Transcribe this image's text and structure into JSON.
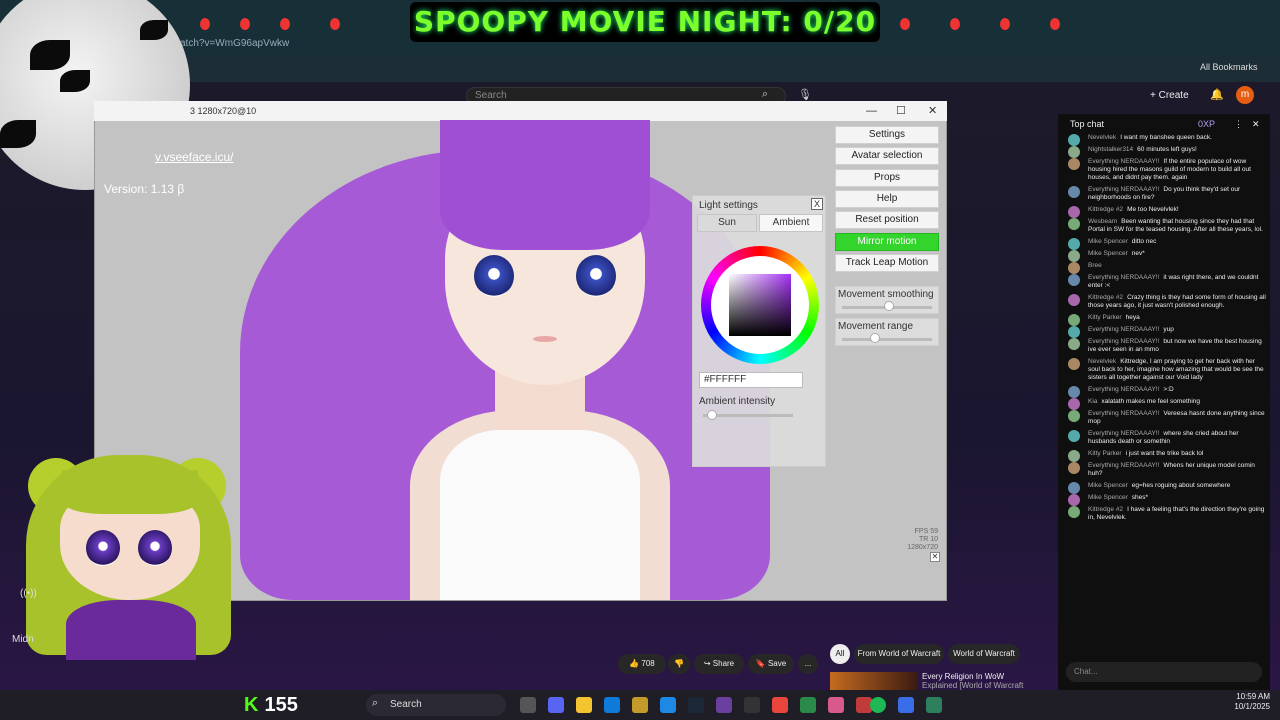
{
  "browser": {
    "address_fragment": "/watch?v=WmG96apVwkw",
    "bookmarks_label": "All Bookmarks"
  },
  "overlay": {
    "banner_text": "SPOOPY MOVIE NIGHT: 0/20",
    "counter_value": "155"
  },
  "youtube": {
    "search_placeholder": "Search",
    "create_label": "Create",
    "account_initial": "m",
    "like_count": "708",
    "share_label": "Share",
    "save_label": "Save",
    "more_label": "...",
    "filter_chips": [
      "All",
      "From World of Warcraft",
      "World of Warcraft"
    ],
    "next_video_title": "Every Religion In WoW",
    "next_video_subtitle": "Explained [World of Warcraft"
  },
  "vseeface": {
    "window_title": "3 1280x720@10",
    "url_text": "v.vseeface.icu/",
    "version_text": "Version: 1.13 β",
    "menu": {
      "settings": "Settings",
      "avatar_selection": "Avatar selection",
      "props": "Props",
      "help": "Help",
      "reset_position": "Reset position",
      "mirror_motion": "Mirror motion",
      "track_leap_motion": "Track Leap Motion"
    },
    "movement_smoothing_label": "Movement smoothing",
    "movement_smoothing_value": 0.53,
    "movement_range_label": "Movement range",
    "movement_range_value": 0.35,
    "light_settings": {
      "title": "Light settings",
      "close": "X",
      "sun_tab": "Sun",
      "ambient_tab": "Ambient",
      "hex_value": "#FFFFFF",
      "ambient_intensity_label": "Ambient intensity",
      "ambient_intensity_value": 0.05
    },
    "fps_readout": [
      "FPS 59",
      "TR 10",
      "1280x720"
    ]
  },
  "chat": {
    "header": "Top chat",
    "points": "0XP",
    "input_placeholder": "Chat...",
    "messages": [
      {
        "user": "Nevelvlek",
        "text": "I want my banshee queen back."
      },
      {
        "user": "Nightstalker314",
        "text": "60 minutes left guys!"
      },
      {
        "user": "Everything NERDAAAY!!",
        "text": "If the entire populace of wow housing hired the masons guild of modern to build all out houses, and didnt pay them. again"
      },
      {
        "user": "Everything NERDAAAY!!",
        "text": "Do you think they'd set our neighborhoods on fire?"
      },
      {
        "user": "Kittredge #2",
        "text": "Me too Nevelvlek!"
      },
      {
        "user": "Wesbeam",
        "text": "Been wanting that housing since they had that Portal in SW for the teased housing. After all these years, lol."
      },
      {
        "user": "Mike Spencer",
        "text": "ditto nec"
      },
      {
        "user": "Mike Spencer",
        "text": "nev*"
      },
      {
        "user": "Bree",
        "text": ""
      },
      {
        "user": "Everything NERDAAAY!!",
        "text": "it was right there, and we couldnt enter :<"
      },
      {
        "user": "Kittredge #2",
        "text": "Crazy thing is they had some form of housing all those years ago, it just wasn't polished enough."
      },
      {
        "user": "Kitty Parker",
        "text": "heya"
      },
      {
        "user": "Everything NERDAAAY!!",
        "text": "yup"
      },
      {
        "user": "Everything NERDAAAY!!",
        "text": "but now we have the best housing ive ever seen in an mmo"
      },
      {
        "user": "Nevelvlek",
        "text": "Kittredge, I am praying to get her back with her soul back to her, imagine how amazing that would be see the sisters all together against our Void lady"
      },
      {
        "user": "Everything NERDAAAY!!",
        "text": ">:D"
      },
      {
        "user": "Kia",
        "text": "xalatath makes me feel something"
      },
      {
        "user": "Everything NERDAAAY!!",
        "text": "Vereesa hasnt done anything since mop"
      },
      {
        "user": "Everything NERDAAAY!!",
        "text": "where she cried about her husbands death or somethin"
      },
      {
        "user": "Kitty Parker",
        "text": "i just want the trike back lol"
      },
      {
        "user": "Everything NERDAAAY!!",
        "text": "Whens her unique model comin huh?"
      },
      {
        "user": "Mike Spencer",
        "text": "eg=hes roguing about somewhere"
      },
      {
        "user": "Mike Spencer",
        "text": "shes*"
      },
      {
        "user": "Kittredge #2",
        "text": "I have a feeling that's the direction they're going in, Nevelvlek."
      }
    ]
  },
  "taskbar": {
    "search_label": "Search",
    "time": "10:59 AM",
    "date": "10/1/2025"
  },
  "colors": {
    "banner_text": "#7cff2b",
    "mirror_motion_active": "#33d52d",
    "hair": "#a65ad6"
  }
}
